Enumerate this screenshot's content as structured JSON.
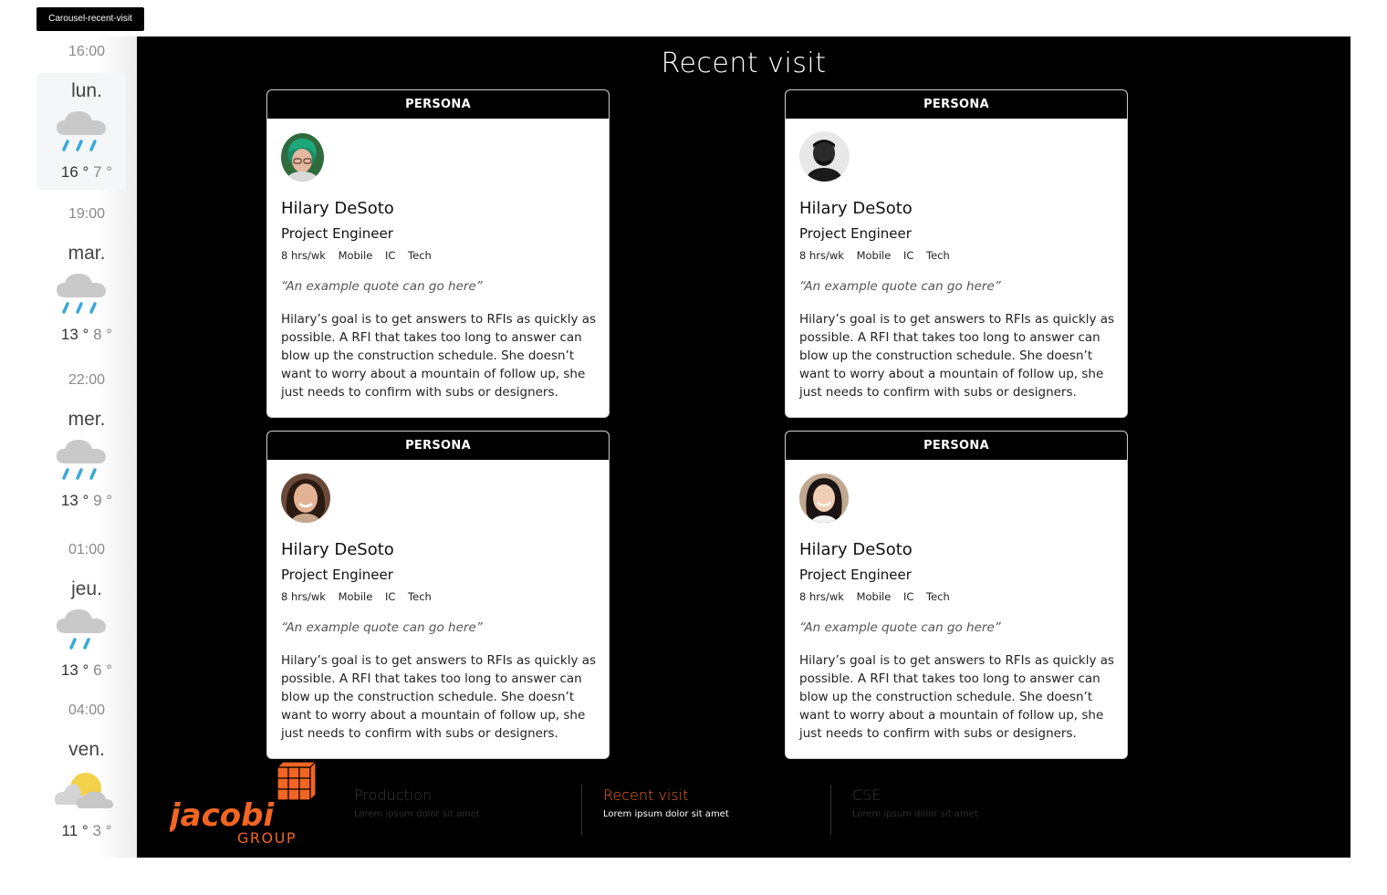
{
  "frame_label": "Carousel-recent-visit",
  "weather": [
    {
      "time": "16:00",
      "day": "lun.",
      "hi": "16 °",
      "lo": "7 °",
      "icon": "rain-cloud-icon"
    },
    {
      "time": "19:00",
      "day": "mar.",
      "hi": "13 °",
      "lo": "8 °",
      "icon": "rain-cloud-icon"
    },
    {
      "time": "22:00",
      "day": "mer.",
      "hi": "13 °",
      "lo": "9 °",
      "icon": "rain-cloud-icon"
    },
    {
      "time": "01:00",
      "day": "jeu.",
      "hi": "13 °",
      "lo": "6 °",
      "icon": "light-rain-cloud-icon"
    },
    {
      "time": "04:00",
      "day": "ven.",
      "hi": "11 °",
      "lo": "3 °",
      "icon": "partly-cloudy-icon"
    }
  ],
  "main": {
    "title": "Recent visit"
  },
  "cards": [
    {
      "header": "PERSONA",
      "name": "Hilary DeSoto",
      "role": "Project Engineer",
      "tags": [
        "8 hrs/wk",
        "Mobile",
        "IC",
        "Tech"
      ],
      "quote": "“An example quote can go here”",
      "description": "Hilary’s goal is to get answers to RFIs as quickly as possible. A RFI that takes too long to answer can blow up the construction schedule. She doesn’t want to worry about a mountain of follow up, she just needs to confirm with subs or designers."
    },
    {
      "header": "PERSONA",
      "name": "Hilary DeSoto",
      "role": "Project Engineer",
      "tags": [
        "8 hrs/wk",
        "Mobile",
        "IC",
        "Tech"
      ],
      "quote": "“An example quote can go here”",
      "description": "Hilary’s goal is to get answers to RFIs as quickly as possible. A RFI that takes too long to answer can blow up the construction schedule. She doesn’t want to worry about a mountain of follow up, she just needs to confirm with subs or designers."
    },
    {
      "header": "PERSONA",
      "name": "Hilary DeSoto",
      "role": "Project Engineer",
      "tags": [
        "8 hrs/wk",
        "Mobile",
        "IC",
        "Tech"
      ],
      "quote": "“An example quote can go here”",
      "description": "Hilary’s goal is to get answers to RFIs as quickly as possible. A RFI that takes too long to answer can blow up the construction schedule. She doesn’t want to worry about a mountain of follow up, she just needs to confirm with subs or designers."
    },
    {
      "header": "PERSONA",
      "name": "Hilary DeSoto",
      "role": "Project Engineer",
      "tags": [
        "8 hrs/wk",
        "Mobile",
        "IC",
        "Tech"
      ],
      "quote": "“An example quote can go here”",
      "description": "Hilary’s goal is to get answers to RFIs as quickly as possible. A RFI that takes too long to answer can blow up the construction schedule. She doesn’t want to worry about a mountain of follow up, she just needs to confirm with subs or designers."
    }
  ],
  "logo": {
    "name": "jacobi",
    "sub": "GROUP",
    "color": "#f26522"
  },
  "nav": [
    {
      "label": "Production",
      "sub": "Lorem ipsum dolor sit amet",
      "active": false
    },
    {
      "label": "Recent visit",
      "sub": "Lorem ipsum dolor sit amet",
      "active": true
    },
    {
      "label": "CSE",
      "sub": "Lorem ipsum dolor sit amet",
      "active": false
    }
  ],
  "colors": {
    "accent": "#f26522",
    "nav_inactive": "#3a3a3a",
    "nav_active_sub": "#ffffff"
  }
}
